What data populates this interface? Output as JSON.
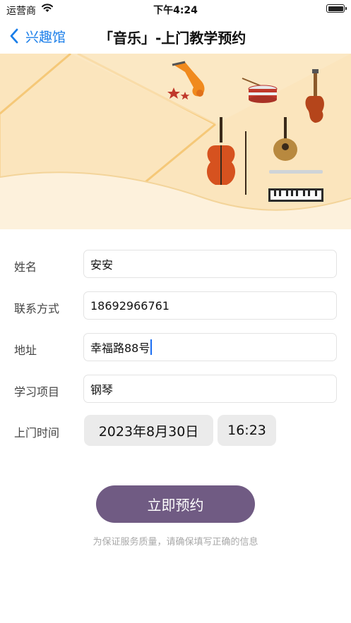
{
  "status_bar": {
    "carrier": "运营商",
    "time": "下午4:24"
  },
  "nav": {
    "back_label": "兴趣馆",
    "title": "「音乐」-上门教学预约"
  },
  "banner": {
    "background": "#fbe5bd",
    "accent": "#f5c878"
  },
  "form": {
    "name": {
      "label": "姓名",
      "value": "安安"
    },
    "contact": {
      "label": "联系方式",
      "value": "18692966761"
    },
    "address": {
      "label": "地址",
      "value": "幸福路88号"
    },
    "subject": {
      "label": "学习项目",
      "value": "钢琴"
    },
    "visit_time": {
      "label": "上门时间",
      "date": "2023年8月30日",
      "time": "16:23"
    }
  },
  "submit": {
    "label": "立即预约",
    "color": "#705b83"
  },
  "hint": "为保证服务质量，请确保填写正确的信息"
}
